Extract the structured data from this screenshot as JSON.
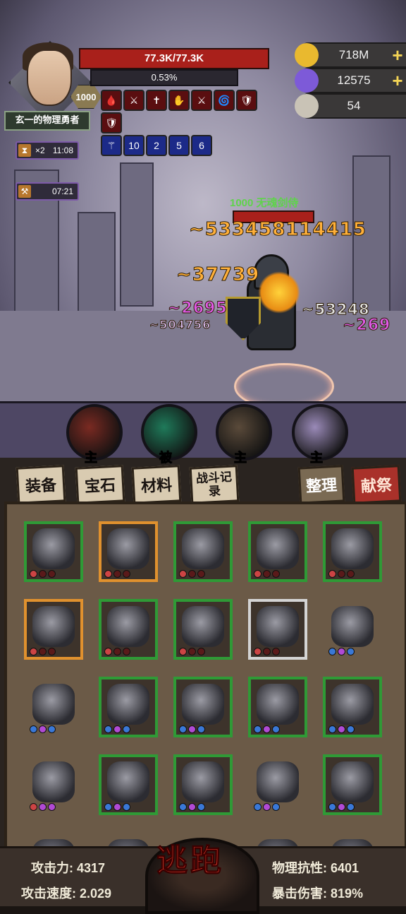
{
  "hero": {
    "level": "1000",
    "name": "玄一的物理勇者",
    "hp_text": "77.3K/77.3K",
    "exp_text": "0.53%"
  },
  "buffs_row1": [
    "🩸",
    "⚔",
    "✝",
    "✋",
    "⚔",
    "🌀",
    "🛡",
    "🛡"
  ],
  "buffs_row2": [
    "⚚",
    "10",
    "2",
    "5",
    "6"
  ],
  "currencies": [
    {
      "name": "gold",
      "value": "718M",
      "icon": "coin-icon",
      "color": "#e9b92f",
      "plus": "+"
    },
    {
      "name": "gem",
      "value": "12575",
      "icon": "crystal-icon",
      "color": "#7d5ad8",
      "plus": "+"
    },
    {
      "name": "skull",
      "value": "54",
      "icon": "skull-icon",
      "color": "#c9c3b6",
      "plus": ""
    }
  ],
  "timers": [
    {
      "icon": "hourglass-icon",
      "label": "×2",
      "time": "11:08"
    },
    {
      "icon": "hammer-icon",
      "label": "",
      "time": "07:21"
    }
  ],
  "enemy": {
    "name": "1000 无魂剑侍"
  },
  "damage_numbers": [
    {
      "text": "~533458114415",
      "cls": "d-orange"
    },
    {
      "text": "~37739",
      "cls": "d-orange"
    },
    {
      "text": "~2695",
      "cls": "d-pink"
    },
    {
      "text": "~504756",
      "cls": "d-purple"
    },
    {
      "text": "~53248",
      "cls": "d-white"
    },
    {
      "text": "~269",
      "cls": "d-pink"
    }
  ],
  "skills": [
    {
      "icon": "sword-skill-icon",
      "tag": "主",
      "color": "#7a2a22"
    },
    {
      "icon": "whirlwind-skill-icon",
      "tag": "被",
      "color": "#1f7a5a"
    },
    {
      "icon": "shield-skill-icon",
      "tag": "主",
      "color": "#5a4a3a"
    },
    {
      "icon": "angel-skill-icon",
      "tag": "主",
      "color": "#9a8ab8"
    }
  ],
  "tabs": {
    "equipment": "装备",
    "gems": "宝石",
    "materials": "材料",
    "battle_log": "战斗记录",
    "organize": "整理",
    "sacrifice": "献祭"
  },
  "items": [
    {
      "icon": "dragon-armor-icon",
      "frame": "green",
      "stars": [
        "red",
        "empty",
        "empty"
      ]
    },
    {
      "icon": "dragon-ring-icon",
      "frame": "orange",
      "stars": [
        "red",
        "empty",
        "empty"
      ]
    },
    {
      "icon": "coat-icon",
      "frame": "green",
      "stars": [
        "red",
        "empty",
        "empty"
      ]
    },
    {
      "icon": "necklace-icon",
      "frame": "green",
      "stars": [
        "red",
        "empty",
        "empty"
      ]
    },
    {
      "icon": "pants-icon",
      "frame": "green",
      "stars": [
        "red",
        "empty",
        "empty"
      ]
    },
    {
      "icon": "dragon-sword-icon",
      "frame": "orange",
      "stars": [
        "red",
        "empty",
        "empty"
      ]
    },
    {
      "icon": "amulet-icon",
      "frame": "green",
      "stars": [
        "red",
        "empty",
        "empty"
      ]
    },
    {
      "icon": "gauntlets-icon",
      "frame": "green",
      "stars": [
        "red",
        "empty",
        "empty"
      ]
    },
    {
      "icon": "wooden-staff-icon",
      "frame": "white",
      "stars": [
        "red",
        "empty",
        "empty"
      ]
    },
    {
      "icon": "skull-helmet-icon",
      "frame": "none",
      "stars": [
        "blue",
        "purple",
        "blue"
      ]
    },
    {
      "icon": "spiked-armor-icon",
      "frame": "none",
      "stars": [
        "blue",
        "purple",
        "blue"
      ]
    },
    {
      "icon": "skull-belt-icon",
      "frame": "green",
      "stars": [
        "blue",
        "purple",
        "blue"
      ]
    },
    {
      "icon": "spiked-gloves-icon",
      "frame": "green",
      "stars": [
        "blue",
        "purple",
        "blue"
      ]
    },
    {
      "icon": "spiked-boots-icon",
      "frame": "green",
      "stars": [
        "blue",
        "purple",
        "blue"
      ]
    },
    {
      "icon": "golden-gauntlets-icon",
      "frame": "green",
      "stars": [
        "blue",
        "purple",
        "blue"
      ]
    },
    {
      "icon": "halo-helmet-icon",
      "frame": "none",
      "stars": [
        "red",
        "purple",
        "purple"
      ]
    },
    {
      "icon": "samurai-armor-icon",
      "frame": "green",
      "stars": [
        "blue",
        "purple",
        "blue"
      ]
    },
    {
      "icon": "steel-boots-icon",
      "frame": "green",
      "stars": [
        "blue",
        "purple",
        "blue"
      ]
    },
    {
      "icon": "plate-armor-icon",
      "frame": "none",
      "stars": [
        "blue",
        "purple",
        "blue"
      ]
    },
    {
      "icon": "fire-belt-icon",
      "frame": "green",
      "stars": [
        "blue",
        "purple",
        "blue"
      ]
    }
  ],
  "stats": {
    "attack_label": "攻击力:",
    "attack_value": "4317",
    "speed_label": "攻击速度:",
    "speed_value": "2.029",
    "phys_res_label": "物理抗性:",
    "phys_res_value": "6401",
    "crit_dmg_label": "暴击伤害:",
    "crit_dmg_value": "819%"
  },
  "flee_button": "逃跑"
}
